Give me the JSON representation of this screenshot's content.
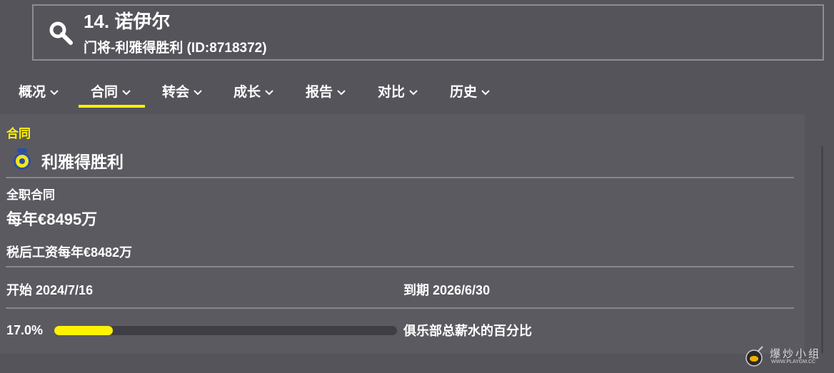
{
  "header": {
    "title": "14. 诺伊尔",
    "subtitle": "门将-利雅得胜利 (ID:8718372)"
  },
  "tabs": [
    {
      "label": "概况",
      "active": false
    },
    {
      "label": "合同",
      "active": true
    },
    {
      "label": "转会",
      "active": false
    },
    {
      "label": "成长",
      "active": false
    },
    {
      "label": "报告",
      "active": false
    },
    {
      "label": "对比",
      "active": false
    },
    {
      "label": "历史",
      "active": false
    }
  ],
  "contract": {
    "section_label": "合同",
    "club_name": "利雅得胜利",
    "contract_type": "全职合同",
    "salary": "每年€8495万",
    "after_tax": "税后工资每年€8482万",
    "start": "开始 2024/7/16",
    "end": "到期 2026/6/30",
    "wage_share_text": "17.0%",
    "wage_share_fraction": 0.17,
    "wage_share_caption": "俱乐部总薪水的百分比"
  },
  "watermark": {
    "text": "爆炒小组",
    "url": "WWW.PLAYGM.CC"
  },
  "colors": {
    "accent": "#fff200",
    "background": "#55545b",
    "panel": "#5b5a61"
  }
}
